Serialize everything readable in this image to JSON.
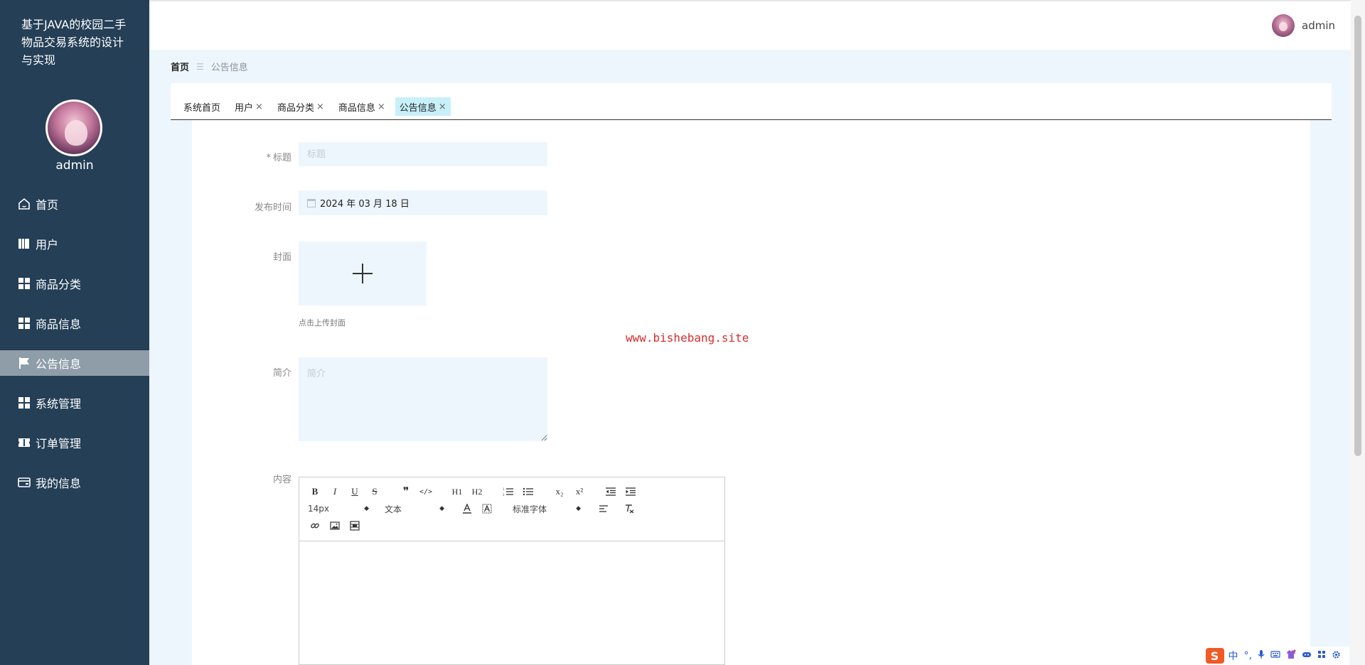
{
  "app": {
    "title": "基于JAVA的校园二手物品交易系统的设计与实现"
  },
  "sidebar": {
    "username": "admin",
    "items": [
      {
        "label": "首页",
        "icon": "home-icon",
        "active": false
      },
      {
        "label": "用户",
        "icon": "users-icon",
        "active": false
      },
      {
        "label": "商品分类",
        "icon": "grid-icon",
        "active": false
      },
      {
        "label": "商品信息",
        "icon": "grid-icon",
        "active": false
      },
      {
        "label": "公告信息",
        "icon": "flag-icon",
        "active": true
      },
      {
        "label": "系统管理",
        "icon": "grid-icon",
        "active": false
      },
      {
        "label": "订单管理",
        "icon": "ticket-icon",
        "active": false
      },
      {
        "label": "我的信息",
        "icon": "card-icon",
        "active": false
      }
    ]
  },
  "header": {
    "username": "admin"
  },
  "breadcrumb": {
    "home": "首页",
    "separator": "☰",
    "current": "公告信息"
  },
  "tabs": [
    {
      "label": "系统首页",
      "closable": false,
      "active": false
    },
    {
      "label": "用户",
      "closable": true,
      "active": false
    },
    {
      "label": "商品分类",
      "closable": true,
      "active": false
    },
    {
      "label": "商品信息",
      "closable": true,
      "active": false
    },
    {
      "label": "公告信息",
      "closable": true,
      "active": true
    }
  ],
  "tab_close_glyph": "×",
  "form": {
    "title": {
      "required_mark": "*",
      "label": "标题",
      "placeholder": "标题",
      "value": ""
    },
    "publish_time": {
      "label": "发布时间",
      "value": "2024 年 03 月 18 日"
    },
    "cover": {
      "label": "封面",
      "tip": "点击上传封面"
    },
    "summary": {
      "label": "简介",
      "placeholder": "简介",
      "value": ""
    },
    "content": {
      "label": "内容",
      "toolbar": {
        "row1": [
          "B",
          "I",
          "U",
          "S",
          "❞",
          "</>",
          "H1",
          "H2",
          "ordered-list",
          "bullet-list",
          "x₂",
          "x²",
          "outdent",
          "indent"
        ],
        "font_size": "14px",
        "header_select": "文本",
        "font_family": "标准字体"
      }
    }
  },
  "watermark": "www.bishebang.site",
  "ime": {
    "lang": "中",
    "symbol": "°,"
  },
  "colors": {
    "sidebar_bg": "#243f56",
    "active_menu_bg": "#8e9da8",
    "content_bg": "#eef6fd",
    "active_tab_bg": "#c7f0f9",
    "watermark": "#d92b2b"
  }
}
